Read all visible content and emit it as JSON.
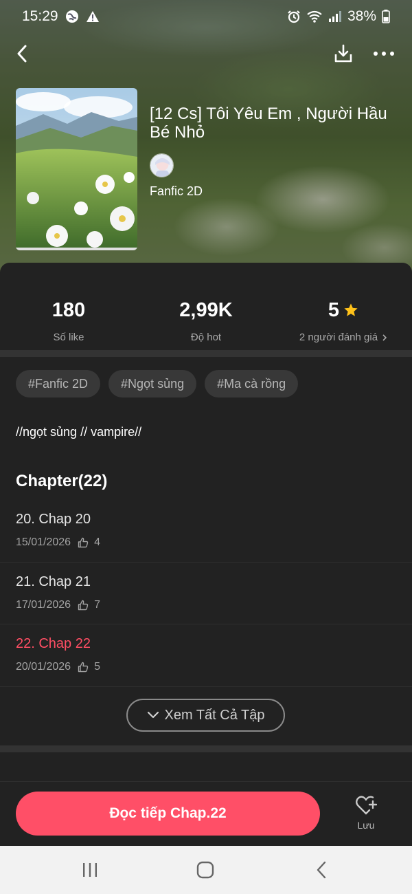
{
  "status_bar": {
    "time": "15:29",
    "battery": "38%",
    "left_icons": [
      "globe-icon",
      "warning-icon"
    ],
    "right_icons": [
      "alarm-icon",
      "wifi-icon",
      "signal-icon",
      "battery-icon"
    ]
  },
  "book": {
    "title": "[12 Cs] Tôi Yêu Em , Người Hầu Bé Nhỏ",
    "category": "Fanfic 2D"
  },
  "stats": {
    "likes_value": "180",
    "likes_label": "Số like",
    "hot_value": "2,99K",
    "hot_label": "Độ hot",
    "rating_value": "5",
    "rating_label": "2 người đánh giá"
  },
  "tags": [
    "#Fanfic 2D",
    "#Ngọt sủng",
    "#Ma cà rồng"
  ],
  "description": "//ngọt sủng // vampire//",
  "chapters": {
    "heading": "Chapter(22)",
    "items": [
      {
        "name": "20. Chap 20",
        "date": "15/01/2026",
        "likes": "4"
      },
      {
        "name": "21. Chap 21",
        "date": "17/01/2026",
        "likes": "7"
      },
      {
        "name": "22. Chap 22",
        "date": "20/01/2026",
        "likes": "5"
      }
    ],
    "see_all_label": "Xem Tất Cả Tập"
  },
  "actions": {
    "read_label": "Đọc tiếp Chap.22",
    "save_label": "Lưu"
  },
  "colors": {
    "accent": "#ff4f67",
    "star": "#ffc21a",
    "panel_bg": "#222222"
  }
}
